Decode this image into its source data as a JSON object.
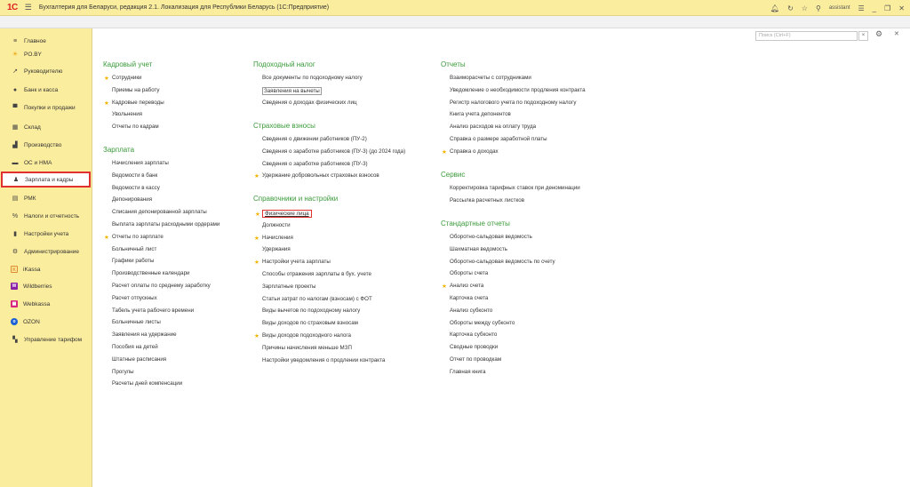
{
  "window": {
    "logo": "1С",
    "title": "Бухгалтерия для Беларуси, редакция 2.1. Локализация для Республики Беларусь  (1С:Предприятие)",
    "user": "assistant"
  },
  "sidebar": {
    "items": [
      {
        "label": "Главное",
        "icon": "menu-icon"
      },
      {
        "label": "PO.BY",
        "icon": "sun-icon"
      },
      {
        "label": "Руководителю",
        "icon": "trend-icon"
      },
      {
        "label": "Банк и касса",
        "icon": "coin-icon"
      },
      {
        "label": "Покупки и продажи",
        "icon": "cart-icon"
      },
      {
        "label": "Склад",
        "icon": "warehouse-icon"
      },
      {
        "label": "Производство",
        "icon": "factory-icon"
      },
      {
        "label": "ОС и НМА",
        "icon": "truck-icon"
      },
      {
        "label": "Зарплата и кадры",
        "icon": "person-icon"
      },
      {
        "label": "РМК",
        "icon": "register-icon"
      },
      {
        "label": "Налоги и отчетность",
        "icon": "percent-icon"
      },
      {
        "label": "Настройки учета",
        "icon": "book-icon"
      },
      {
        "label": "Администрирование",
        "icon": "gear-icon"
      },
      {
        "label": "iKassa",
        "icon": "ikassa-icon"
      },
      {
        "label": "Wildberries",
        "icon": "wildberries-icon"
      },
      {
        "label": "Webkassa",
        "icon": "webkassa-icon"
      },
      {
        "label": "OZON",
        "icon": "ozon-icon"
      },
      {
        "label": "Управление тарифом",
        "icon": "tariff-icon"
      }
    ]
  },
  "search": {
    "placeholder": "Поиск (Ctrl+F)"
  },
  "colors": {
    "accent_green": "#3a9a3a",
    "sidebar_bg": "#fbed9e",
    "highlight_red": "#e03030",
    "star": "#f2b400"
  },
  "col1": {
    "kadr_title": "Кадровый учет",
    "kadr": [
      "Сотрудники",
      "Приемы на работу",
      "Кадровые переводы",
      "Увольнения",
      "Отчеты по кадрам"
    ],
    "zp_title": "Зарплата",
    "zp": [
      "Начисления зарплаты",
      "Ведомости в банк",
      "Ведомости в кассу",
      "Депонирования",
      "Списания депонированной зарплаты",
      "Выплата зарплаты расходными ордерами",
      "Отчеты по зарплате",
      "Больничный лист",
      "Графики работы",
      "Производственные календари",
      "Расчет оплаты по среднему заработку",
      "Расчет отпускных",
      "Табель учета рабочего времени",
      "Больничные листы",
      "Заявления на удержание",
      "Пособия на детей",
      "Штатные расписания",
      "Прогулы",
      "Расчеты дней компенсации"
    ]
  },
  "col2": {
    "ndfl_title": "Подоходный налог",
    "ndfl": [
      "Все документы по подоходному налогу",
      "Заявления на вычеты",
      "Сведения о доходах физических лиц"
    ],
    "sv_title": "Страховые взносы",
    "sv": [
      "Сведения о движении работников (ПУ-2)",
      "Сведения о заработке работников (ПУ-3) (до 2024 года)",
      "Сведения о заработке работников (ПУ-3)",
      "Удержание добровольных страховых взносов"
    ],
    "spr_title": "Справочники и настройки",
    "spr": [
      "Физические лица",
      "Должности",
      "Начисления",
      "Удержания",
      "Настройки учета зарплаты",
      "Способы отражения зарплаты в бух. учете",
      "Зарплатные проекты",
      "Статьи затрат по налогам (взносам) с ФОТ",
      "Виды вычетов по подоходному налогу",
      "Виды доходов по страховым взносам",
      "Виды доходов подоходного налога",
      "Причины начисления меньше МЗП",
      "Настройки уведомления о продлении контракта"
    ]
  },
  "col3": {
    "otch_title": "Отчеты",
    "otch": [
      "Взаиморасчеты с сотрудниками",
      "Уведомление о необходимости продления контракта",
      "Регистр налогового учета по подоходному налогу",
      "Книга учета депонентов",
      "Анализ расходов на оплату труда",
      "Справка о размере заработной платы",
      "Справка о доходах"
    ],
    "serv_title": "Сервис",
    "serv": [
      "Корректировка тарифных ставок при деноминации",
      "Рассылка расчетных листков"
    ],
    "std_title": "Стандартные отчеты",
    "std": [
      "Оборотно-сальдовая ведомость",
      "Шахматная ведомость",
      "Оборотно-сальдовая ведомость по счету",
      "Обороты счета",
      "Анализ счета",
      "Карточка счета",
      "Анализ субконто",
      "Обороты между субконто",
      "Карточка субконто",
      "Сводные проводки",
      "Отчет по проводкам",
      "Главная книга"
    ]
  }
}
